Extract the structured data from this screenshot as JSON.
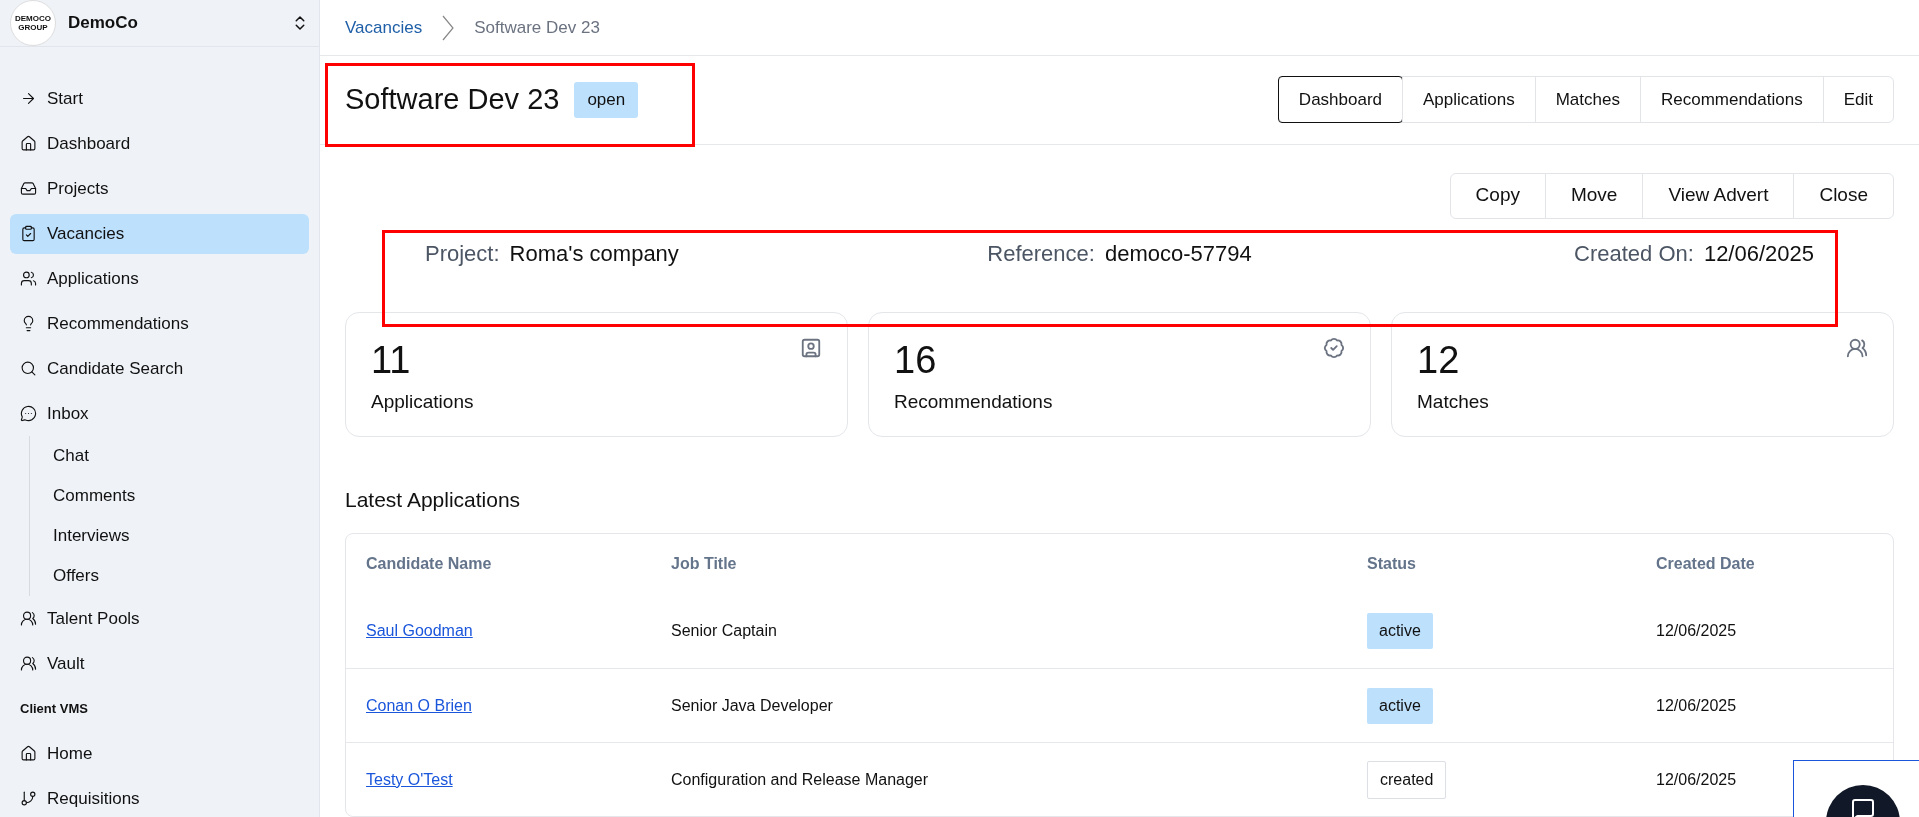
{
  "sidebar": {
    "logo_lines": [
      "DEMOCO",
      "GROUP"
    ],
    "org": "DemoCo",
    "items": [
      {
        "kind": "item",
        "label": "Start",
        "selected": false
      },
      {
        "kind": "item",
        "label": "Dashboard",
        "selected": false
      },
      {
        "kind": "item",
        "label": "Projects",
        "selected": false
      },
      {
        "kind": "item",
        "label": "Vacancies",
        "selected": true
      },
      {
        "kind": "item",
        "label": "Applications",
        "selected": false
      },
      {
        "kind": "item",
        "label": "Recommendations",
        "selected": false
      },
      {
        "kind": "item",
        "label": "Candidate Search",
        "selected": false
      },
      {
        "kind": "item",
        "label": "Inbox",
        "selected": false,
        "children": [
          {
            "label": "Chat",
            "selected": false
          },
          {
            "label": "Comments",
            "selected": false
          },
          {
            "label": "Interviews",
            "selected": false
          },
          {
            "label": "Offers",
            "selected": false
          }
        ]
      },
      {
        "kind": "item",
        "label": "Talent Pools",
        "selected": false
      },
      {
        "kind": "item",
        "label": "Vault",
        "selected": false
      },
      {
        "kind": "heading",
        "label": "Client VMS"
      },
      {
        "kind": "item",
        "label": "Home",
        "selected": false
      },
      {
        "kind": "item",
        "label": "Requisitions",
        "selected": false
      }
    ]
  },
  "breadcrumb": [
    "Vacancies",
    "Software Dev 23"
  ],
  "title": "Software Dev 23",
  "status_badge": "open",
  "tabs": [
    {
      "label": "Dashboard",
      "selected": true
    },
    {
      "label": "Applications",
      "selected": false
    },
    {
      "label": "Matches",
      "selected": false
    },
    {
      "label": "Recommendations",
      "selected": false
    },
    {
      "label": "Edit",
      "selected": false
    }
  ],
  "actions": [
    "Copy",
    "Move",
    "View Advert",
    "Close"
  ],
  "info": [
    {
      "label": "Project:",
      "value": "Roma's company"
    },
    {
      "label": "Reference:",
      "value": "democo-57794"
    },
    {
      "label": "Created On:",
      "value": "12/06/2025"
    }
  ],
  "stats": [
    {
      "value": "11",
      "label": "Applications"
    },
    {
      "value": "16",
      "label": "Recommendations"
    },
    {
      "value": "12",
      "label": "Matches"
    }
  ],
  "latest": {
    "title": "Latest Applications",
    "columns": [
      "Candidate Name",
      "Job Title",
      "Status",
      "Created Date"
    ],
    "rows": [
      {
        "candidate": "Saul Goodman",
        "job": "Senior Captain",
        "status": "active",
        "status_highlighted": true,
        "date": "12/06/2025"
      },
      {
        "candidate": "Conan O Brien",
        "job": "Senior Java Developer",
        "status": "active",
        "status_highlighted": true,
        "date": "12/06/2025"
      },
      {
        "candidate": "Testy O'Test",
        "job": "Configuration and Release Manager",
        "status": "created",
        "status_highlighted": false,
        "date": "12/06/2025"
      }
    ]
  }
}
